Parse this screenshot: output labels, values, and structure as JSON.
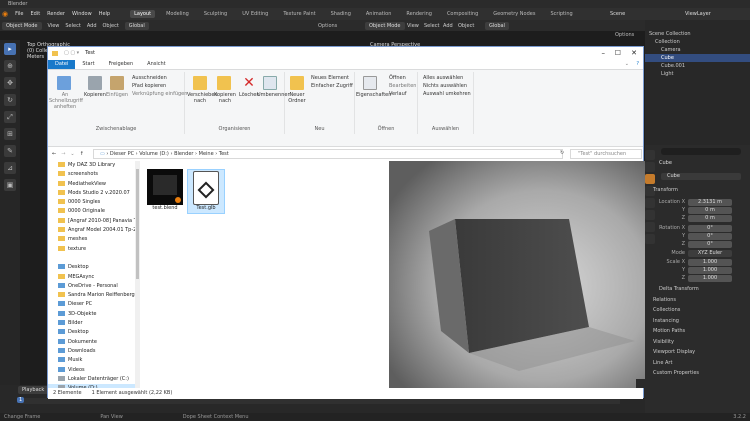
{
  "window_title": "Blender",
  "menus": [
    "File",
    "Edit",
    "Render",
    "Window",
    "Help"
  ],
  "workspaces": [
    "Layout",
    "Modeling",
    "Sculpting",
    "UV Editing",
    "Texture Paint",
    "Shading",
    "Animation",
    "Rendering",
    "Compositing",
    "Geometry Nodes",
    "Scripting"
  ],
  "active_workspace": "Layout",
  "scene_label": "Scene",
  "viewlayer_label": "ViewLayer",
  "header_left": {
    "mode": "Object Mode",
    "view": "View",
    "select": "Select",
    "add": "Add",
    "object": "Object",
    "transform": "Global",
    "options": "Options"
  },
  "header_right": {
    "mode": "Object Mode",
    "view": "View",
    "select": "Select",
    "add": "Add",
    "object": "Object",
    "transform": "Global",
    "options": "Options"
  },
  "left_viewport_overlay": [
    "Top Orthographic",
    "(0) Collection",
    "Meters"
  ],
  "right_viewport_overlay": "Camera Perspective",
  "outliner": {
    "items": [
      "Scene Collection",
      "Collection",
      "Camera",
      "Cube",
      "Cube.001",
      "Light"
    ]
  },
  "properties": {
    "object_name": "Cube",
    "object_field": "Cube",
    "transform_label": "Transform",
    "location_label": "Location X",
    "location": [
      "2.3131 m",
      "0 m",
      "0 m"
    ],
    "rotation_label": "Rotation X",
    "rotation": [
      "0°",
      "0°",
      "0°"
    ],
    "mode_label": "Mode",
    "mode_value": "XYZ Euler",
    "scale_label": "Scale X",
    "scale": [
      "1.000",
      "1.000",
      "1.000"
    ],
    "axis_y": "Y",
    "axis_z": "Z",
    "sections": [
      "Delta Transform",
      "Relations",
      "Collections",
      "Instancing",
      "Motion Paths",
      "Visibility",
      "Viewport Display",
      "Line Art",
      "Custom Properties"
    ]
  },
  "timeline": {
    "playback": "Playback",
    "frame": "1"
  },
  "statusbar": [
    "Change Frame",
    "Pan View",
    "Dope Sheet Context Menu"
  ],
  "version": "3.2.2",
  "explorer": {
    "title": "Test",
    "tabs": [
      "Datei",
      "Start",
      "Freigeben",
      "Ansicht"
    ],
    "ribbon": {
      "pin_label": "An Schnellzugriff anheften",
      "copy_label": "Kopieren",
      "paste_label": "Einfügen",
      "cut_label": "Ausschneiden",
      "copy_path_label": "Pfad kopieren",
      "paste_shortcut_label": "Verknüpfung einfügen",
      "group_clipboard": "Zwischenablage",
      "move_label": "Verschieben nach",
      "copyto_label": "Kopieren nach",
      "delete_label": "Löschen",
      "rename_label": "Umbenennen",
      "group_organize": "Organisieren",
      "newfolder_label": "Neuer Ordner",
      "newitem_label": "Neues Element",
      "easyaccess_label": "Einfacher Zugriff",
      "group_new": "Neu",
      "properties_label": "Eigenschaften",
      "open_label": "Öffnen",
      "edit_label": "Bearbeiten",
      "history_label": "Verlauf",
      "group_open": "Öffnen",
      "selectall_label": "Alles auswählen",
      "selectnone_label": "Nichts auswählen",
      "invert_label": "Auswahl umkehren",
      "group_select": "Auswählen"
    },
    "address": [
      "Dieser PC",
      "Volume (D:)",
      "Blender",
      "Meine",
      "Test"
    ],
    "search_placeholder": "\"Test\" durchsuchen",
    "nav_items": [
      {
        "label": "My DAZ 3D Library",
        "kind": "folder",
        "pinned": true
      },
      {
        "label": "screenshots",
        "kind": "folder",
        "pinned": true
      },
      {
        "label": "MediathekView",
        "kind": "folder",
        "pinned": true
      },
      {
        "label": "Mods Studio 2 v.2020.07",
        "kind": "folder",
        "pinned": true
      },
      {
        "label": "0000 Singles",
        "kind": "folder",
        "pinned": true
      },
      {
        "label": "0000 Originale",
        "kind": "folder",
        "pinned": true
      },
      {
        "label": "[Angraf 2010-08] Panavia Tornado",
        "kind": "folder",
        "pinned": true
      },
      {
        "label": "Angraf Model 2004.01 Tp-2",
        "kind": "folder",
        "pinned": true
      },
      {
        "label": "meshes",
        "kind": "folder",
        "pinned": false
      },
      {
        "label": "texture",
        "kind": "folder",
        "pinned": false
      },
      {
        "label": "",
        "kind": "spacer",
        "pinned": false
      },
      {
        "label": "Desktop",
        "kind": "pc",
        "pinned": false
      },
      {
        "label": "MEGAsync",
        "kind": "folder",
        "pinned": false
      },
      {
        "label": "OneDrive - Personal",
        "kind": "pc",
        "pinned": false
      },
      {
        "label": "Sandra Marion Reiffenberg",
        "kind": "folder",
        "pinned": false
      },
      {
        "label": "Dieser PC",
        "kind": "pc",
        "pinned": false
      },
      {
        "label": "3D-Objekte",
        "kind": "pc",
        "pinned": false
      },
      {
        "label": "Bilder",
        "kind": "pc",
        "pinned": false
      },
      {
        "label": "Desktop",
        "kind": "pc",
        "pinned": false
      },
      {
        "label": "Dokumente",
        "kind": "pc",
        "pinned": false
      },
      {
        "label": "Downloads",
        "kind": "pc",
        "pinned": false
      },
      {
        "label": "Musik",
        "kind": "pc",
        "pinned": false
      },
      {
        "label": "Videos",
        "kind": "pc",
        "pinned": false
      },
      {
        "label": "Lokaler Datenträger (C:)",
        "kind": "drv",
        "pinned": false
      },
      {
        "label": "Volume (D:)",
        "kind": "drv",
        "pinned": false,
        "selected": true
      },
      {
        "label": "Volume (E:)",
        "kind": "drv",
        "pinned": false
      },
      {
        "label": "BD-ROM-Laufwerk (F:) Virtual CD",
        "kind": "drv",
        "pinned": false
      },
      {
        "label": "CD-Laufwerk (G:)",
        "kind": "drv",
        "pinned": false
      },
      {
        "label": "DVD-RW-Laufwerk (N:) T0309_E",
        "kind": "drv",
        "pinned": false
      }
    ],
    "files": [
      {
        "name": "test.blend",
        "selected": false
      },
      {
        "name": "Test.glb",
        "selected": true
      }
    ],
    "status_count": "2 Elemente",
    "status_selected": "1 Element ausgewählt (2,22 KB)"
  },
  "colors": {
    "accent": "#4772b3",
    "explorer_blue": "#1979ca",
    "selection": "#cce8ff"
  }
}
